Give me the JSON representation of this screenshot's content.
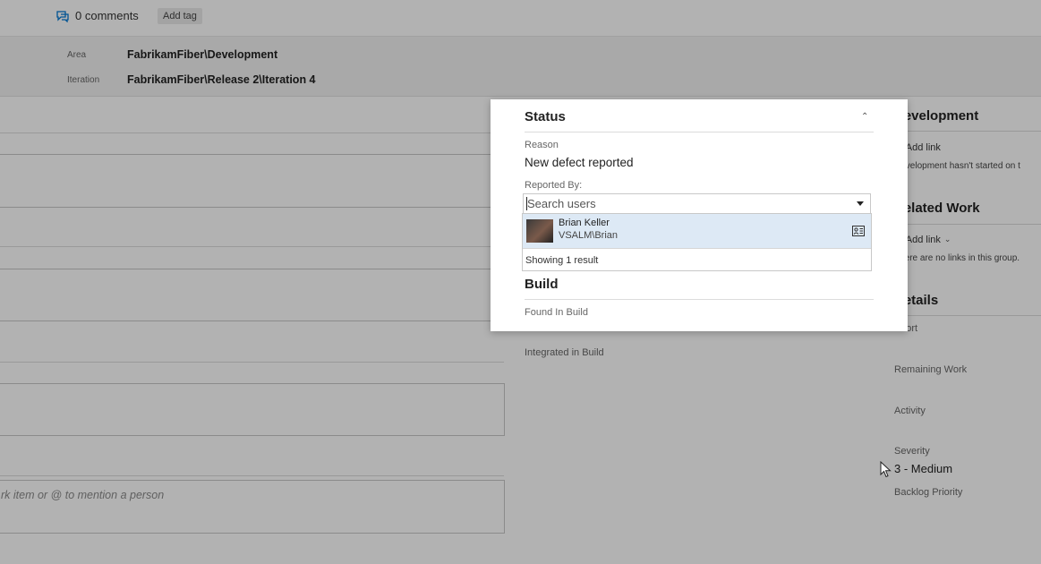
{
  "header": {
    "comments_label": "0 comments",
    "add_tag_label": "Add tag"
  },
  "info": {
    "area_label": "Area",
    "area_value": "FabrikamFiber\\Development",
    "iteration_label": "Iteration",
    "iteration_value": "FabrikamFiber\\Release 2\\Iteration 4"
  },
  "discussion": {
    "placeholder": "rk item or @ to mention a person"
  },
  "popup": {
    "status_title": "Status",
    "reason_label": "Reason",
    "reason_value": "New defect reported",
    "reported_by_label": "Reported By:",
    "search_placeholder": "Search users",
    "result": {
      "name": "Brian Keller",
      "account": "VSALM\\Brian"
    },
    "result_count": "Showing 1 result",
    "build_title": "Build",
    "found_in_build_label": "Found In Build"
  },
  "build_extra": {
    "integrated_in_build_label": "Integrated in Build"
  },
  "right": {
    "development_title": "Development",
    "add_link_label": "Add link",
    "development_empty": "Development hasn't started on t",
    "related_work_title": "Related Work",
    "related_add_link_label": "Add link",
    "related_empty": "There are no links in this group.",
    "details_title": "Details",
    "effort_label": "Effort",
    "remaining_work_label": "Remaining Work",
    "activity_label": "Activity",
    "severity_label": "Severity",
    "severity_value": "3 - Medium",
    "backlog_priority_label": "Backlog Priority"
  },
  "colors": {
    "accent_green": "#107c10",
    "selection_blue": "#dde9f5",
    "link_blue": "#0078d4"
  }
}
